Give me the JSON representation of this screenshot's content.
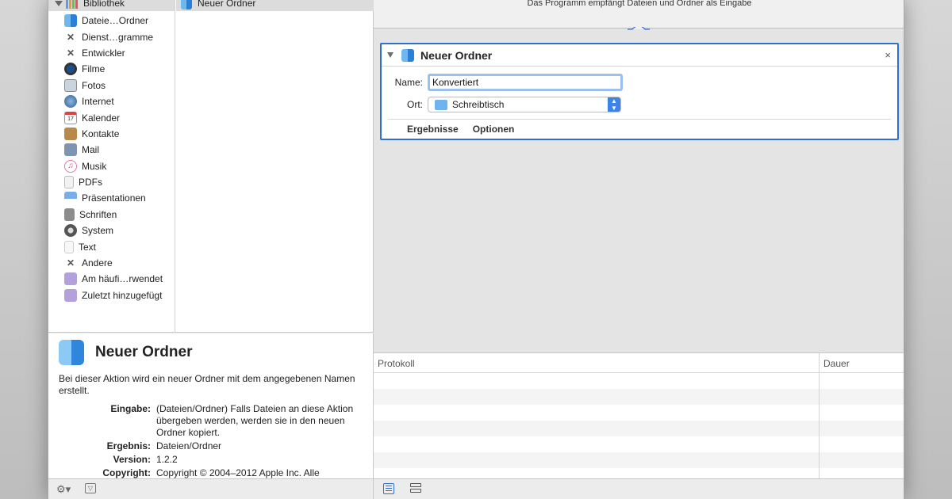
{
  "workflow": {
    "input_hint": "Das Programm empfängt Dateien und Ordner als Eingabe"
  },
  "library": {
    "root_label": "Bibliothek",
    "items": [
      {
        "label": "Dateie…Ordner",
        "icon": "finder-icon"
      },
      {
        "label": "Dienst…gramme",
        "icon": "utilities-icon"
      },
      {
        "label": "Entwickler",
        "icon": "developer-icon"
      },
      {
        "label": "Filme",
        "icon": "movies-icon"
      },
      {
        "label": "Fotos",
        "icon": "photos-icon"
      },
      {
        "label": "Internet",
        "icon": "internet-icon"
      },
      {
        "label": "Kalender",
        "icon": "calendar-icon"
      },
      {
        "label": "Kontakte",
        "icon": "contacts-icon"
      },
      {
        "label": "Mail",
        "icon": "mail-icon"
      },
      {
        "label": "Musik",
        "icon": "music-icon"
      },
      {
        "label": "PDFs",
        "icon": "pdf-icon"
      },
      {
        "label": "Präsentationen",
        "icon": "presentation-icon"
      },
      {
        "label": "Schriften",
        "icon": "fonts-icon"
      },
      {
        "label": "System",
        "icon": "system-icon"
      },
      {
        "label": "Text",
        "icon": "text-icon"
      },
      {
        "label": "Andere",
        "icon": "other-icon"
      }
    ],
    "smart_folders": [
      {
        "label": "Am häufi…rwendet",
        "icon": "smart-folder-icon"
      },
      {
        "label": "Zuletzt hinzugefügt",
        "icon": "smart-folder-icon"
      }
    ],
    "actions": [
      {
        "label": "Neuer Ordner",
        "icon": "finder-icon"
      }
    ]
  },
  "description": {
    "title": "Neuer Ordner",
    "text": "Bei dieser Aktion wird ein neuer Ordner mit dem angegebenen Namen erstellt.",
    "fields": {
      "input_label": "Eingabe:",
      "input_value": "(Dateien/Ordner) Falls Dateien an diese Aktion übergeben werden, werden sie in den neuen Ordner kopiert.",
      "result_label": "Ergebnis:",
      "result_value": "Dateien/Ordner",
      "version_label": "Version:",
      "version_value": "1.2.2",
      "copyright_label": "Copyright:",
      "copyright_value": "Copyright © 2004–2012 Apple Inc. Alle"
    }
  },
  "action": {
    "title": "Neuer Ordner",
    "name_label": "Name:",
    "name_value": "Konvertiert",
    "location_label": "Ort:",
    "location_value": "Schreibtisch",
    "tab_results": "Ergebnisse",
    "tab_options": "Optionen",
    "close_glyph": "×"
  },
  "log": {
    "col_log": "Protokoll",
    "col_duration": "Dauer"
  },
  "colors": {
    "accent": "#2e6fd0",
    "selected_row": "#dcdcdc"
  }
}
